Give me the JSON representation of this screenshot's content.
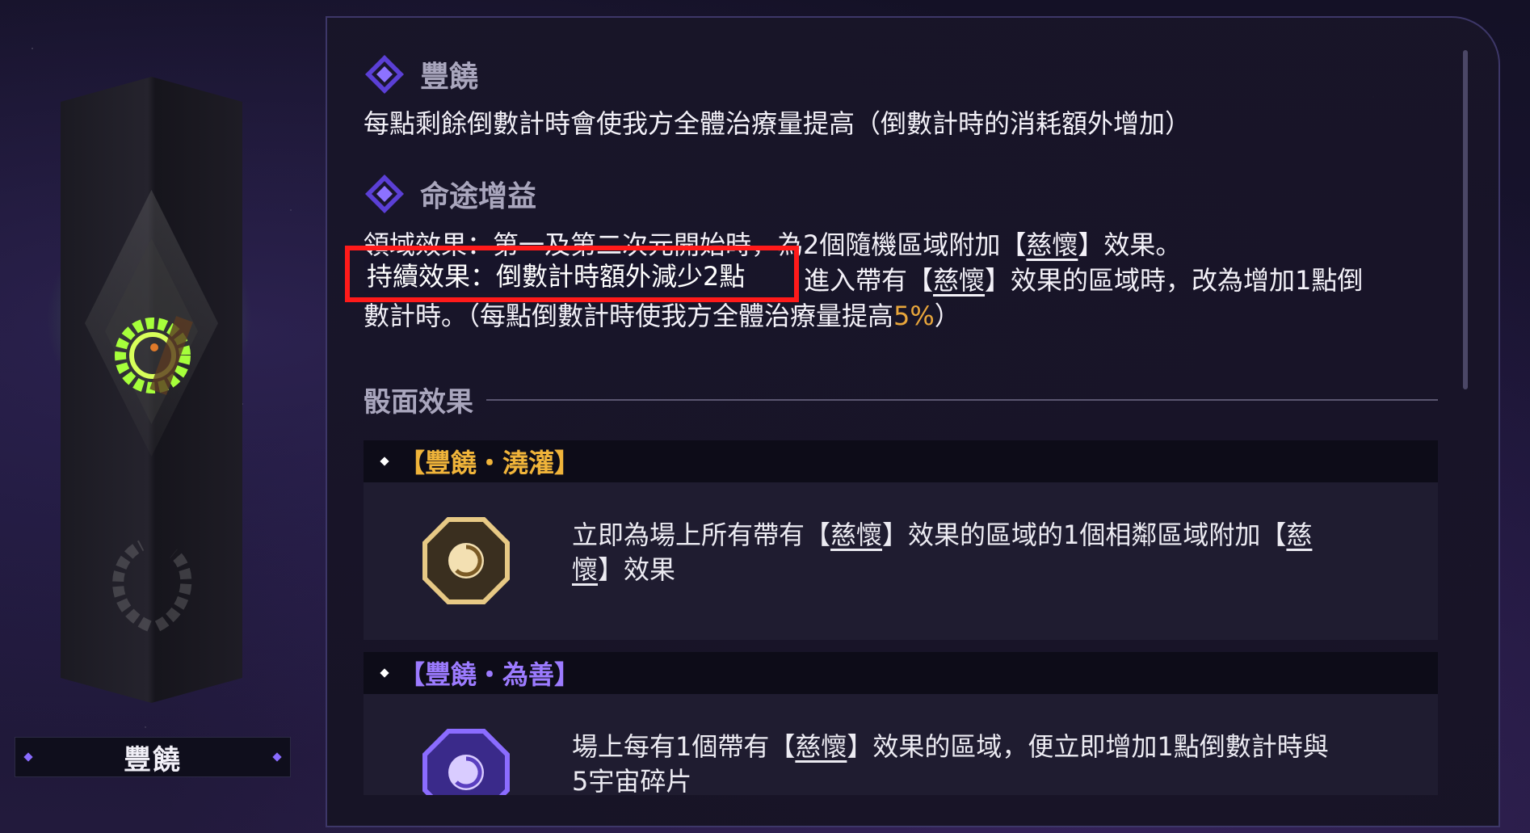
{
  "sidebar": {
    "name": "豐饒"
  },
  "path": {
    "title": "豐饒",
    "description": "每點剩餘倒數計時會使我方全體治療量提高（倒數計時的消耗額外增加）"
  },
  "path_buff": {
    "title": "命途增益",
    "line1_a": "領域效果：第一及第二次元開始時，為2個隨機區域附加【",
    "line1_kw": "慈懷",
    "line1_b": "】效果。",
    "line2_highlight": "持續效果：倒數計時額外減少2點",
    "line2_a": "進入帶有【",
    "line2_kw": "慈懷",
    "line2_b": "】效果的區域時，改為增加1點倒",
    "line3_a": "數計時。（每點倒數計時使我方全體治療量提高",
    "line3_value": "5%",
    "line3_b": "）"
  },
  "dice_section": {
    "title": "骰面效果"
  },
  "cards": [
    {
      "title": "【豐饒・澆灌】",
      "title_color": "#f0b43a",
      "icon": "gold-octagon-swirl-icon",
      "text_a": "立即為場上所有帶有【",
      "kw1": "慈懷",
      "text_b": "】效果的區域的1個相鄰區域附加【",
      "kw2a": "慈",
      "kw2b": "懷",
      "text_c": "】效果"
    },
    {
      "title": "【豐饒・為善】",
      "title_color": "#9c7bff",
      "icon": "purple-octagon-swirl-icon",
      "text_a": "場上每有1個帶有【",
      "kw1": "慈懷",
      "text_b": "】效果的區域，便立即增加1點倒數計時與",
      "text_c": "5宇宙碎片"
    }
  ],
  "colors": {
    "accent_gold": "#e8a63b",
    "highlight_red": "#ff1a1a",
    "path_purple": "#7b5cff"
  }
}
